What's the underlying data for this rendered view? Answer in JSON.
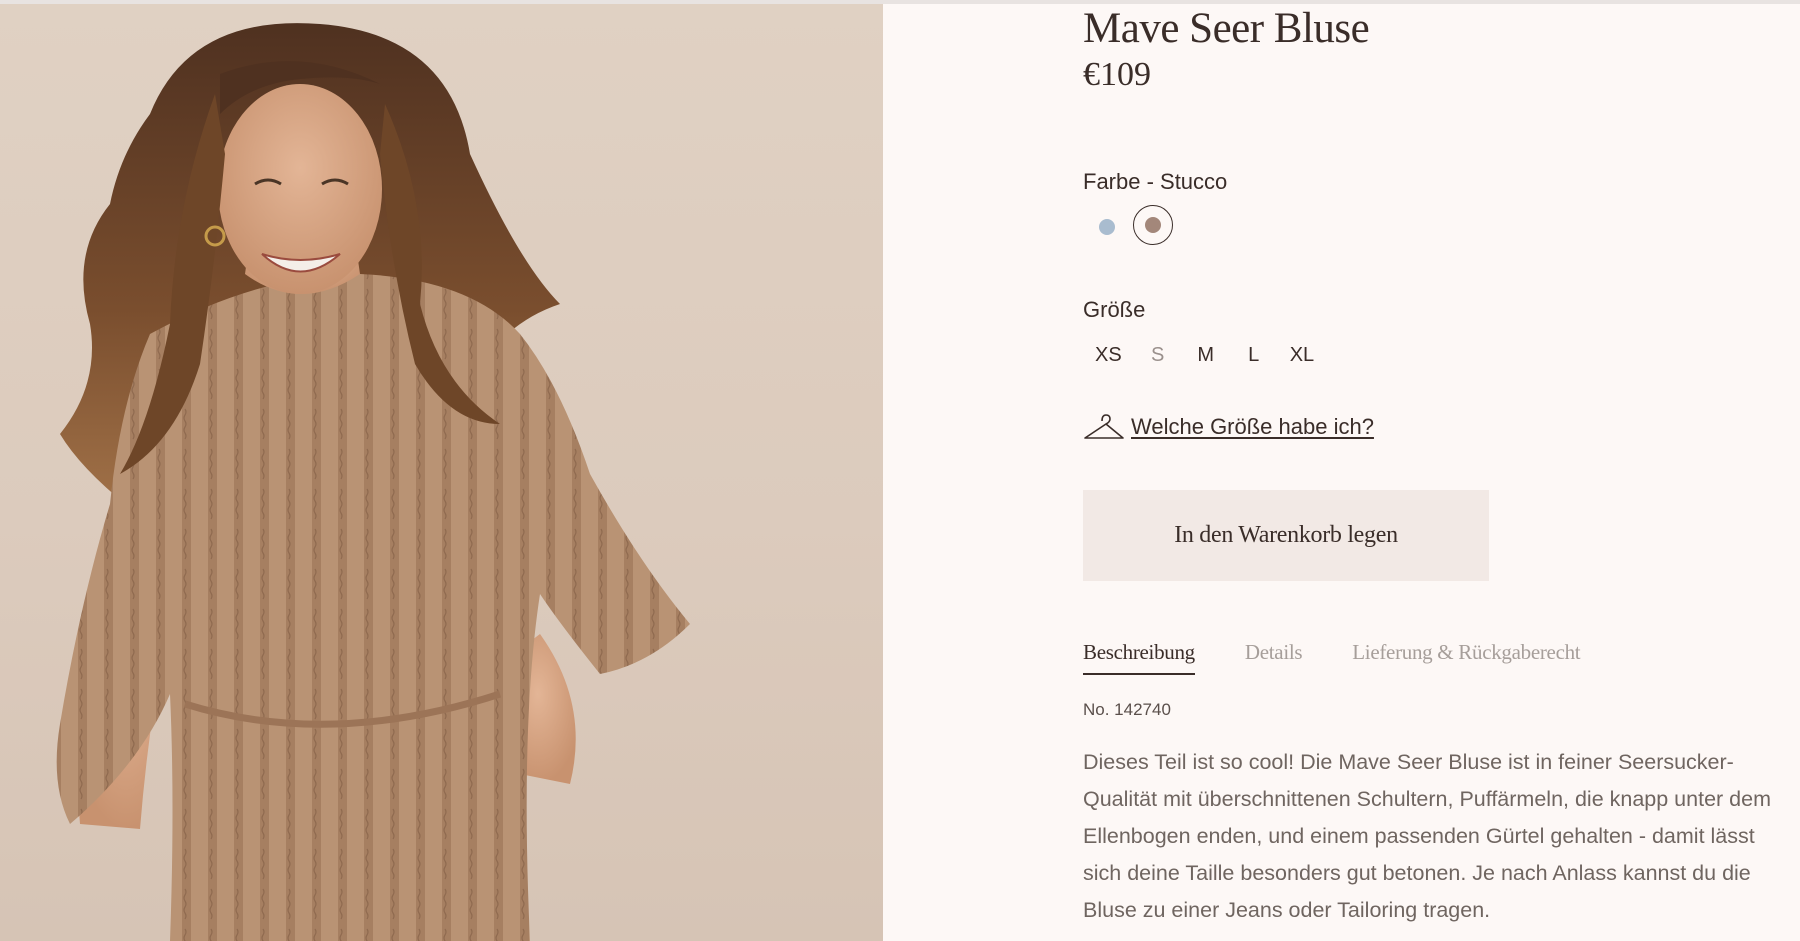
{
  "product": {
    "title": "Mave Seer Bluse",
    "price": "€109",
    "image_alt": "Model trägt Mave Seer Bluse in Stucco"
  },
  "color": {
    "label": "Farbe - Stucco",
    "swatches": [
      {
        "name": "blue",
        "hex": "#a9bccf",
        "selected": false
      },
      {
        "name": "stucco",
        "hex": "#a3877a",
        "selected": true
      }
    ]
  },
  "size": {
    "label": "Größe",
    "options": [
      {
        "label": "XS",
        "available": true
      },
      {
        "label": "S",
        "available": false
      },
      {
        "label": "M",
        "available": true
      },
      {
        "label": "L",
        "available": true
      },
      {
        "label": "XL",
        "available": true
      }
    ],
    "help_link": "Welche Größe habe ich?",
    "help_icon": "hanger-icon"
  },
  "cart": {
    "button_label": "In den Warenkorb legen"
  },
  "tabs": [
    {
      "label": "Beschreibung",
      "active": true
    },
    {
      "label": "Details",
      "active": false
    },
    {
      "label": "Lieferung & Rückgaberecht",
      "active": false
    }
  ],
  "description": {
    "article_no": "No. 142740",
    "text": "Dieses Teil ist so cool! Die Mave Seer Bluse ist in feiner Seersucker-Qualität mit überschnittenen Schultern, Puffärmeln, die knapp unter dem Ellenbogen enden, und einem passenden Gürtel gehalten - damit lässt sich deine Taille besonders gut betonen. Je nach Anlass kannst du die Bluse zu einer Jeans oder Tailoring tragen."
  },
  "colors": {
    "background": "#fdf8f6",
    "text": "#3a2d29",
    "muted_text": "#a69e9a",
    "button_bg": "#f2e9e5",
    "image_bg": "#dccbbd",
    "blouse": "#b8906f",
    "hair": "#6a4128"
  }
}
